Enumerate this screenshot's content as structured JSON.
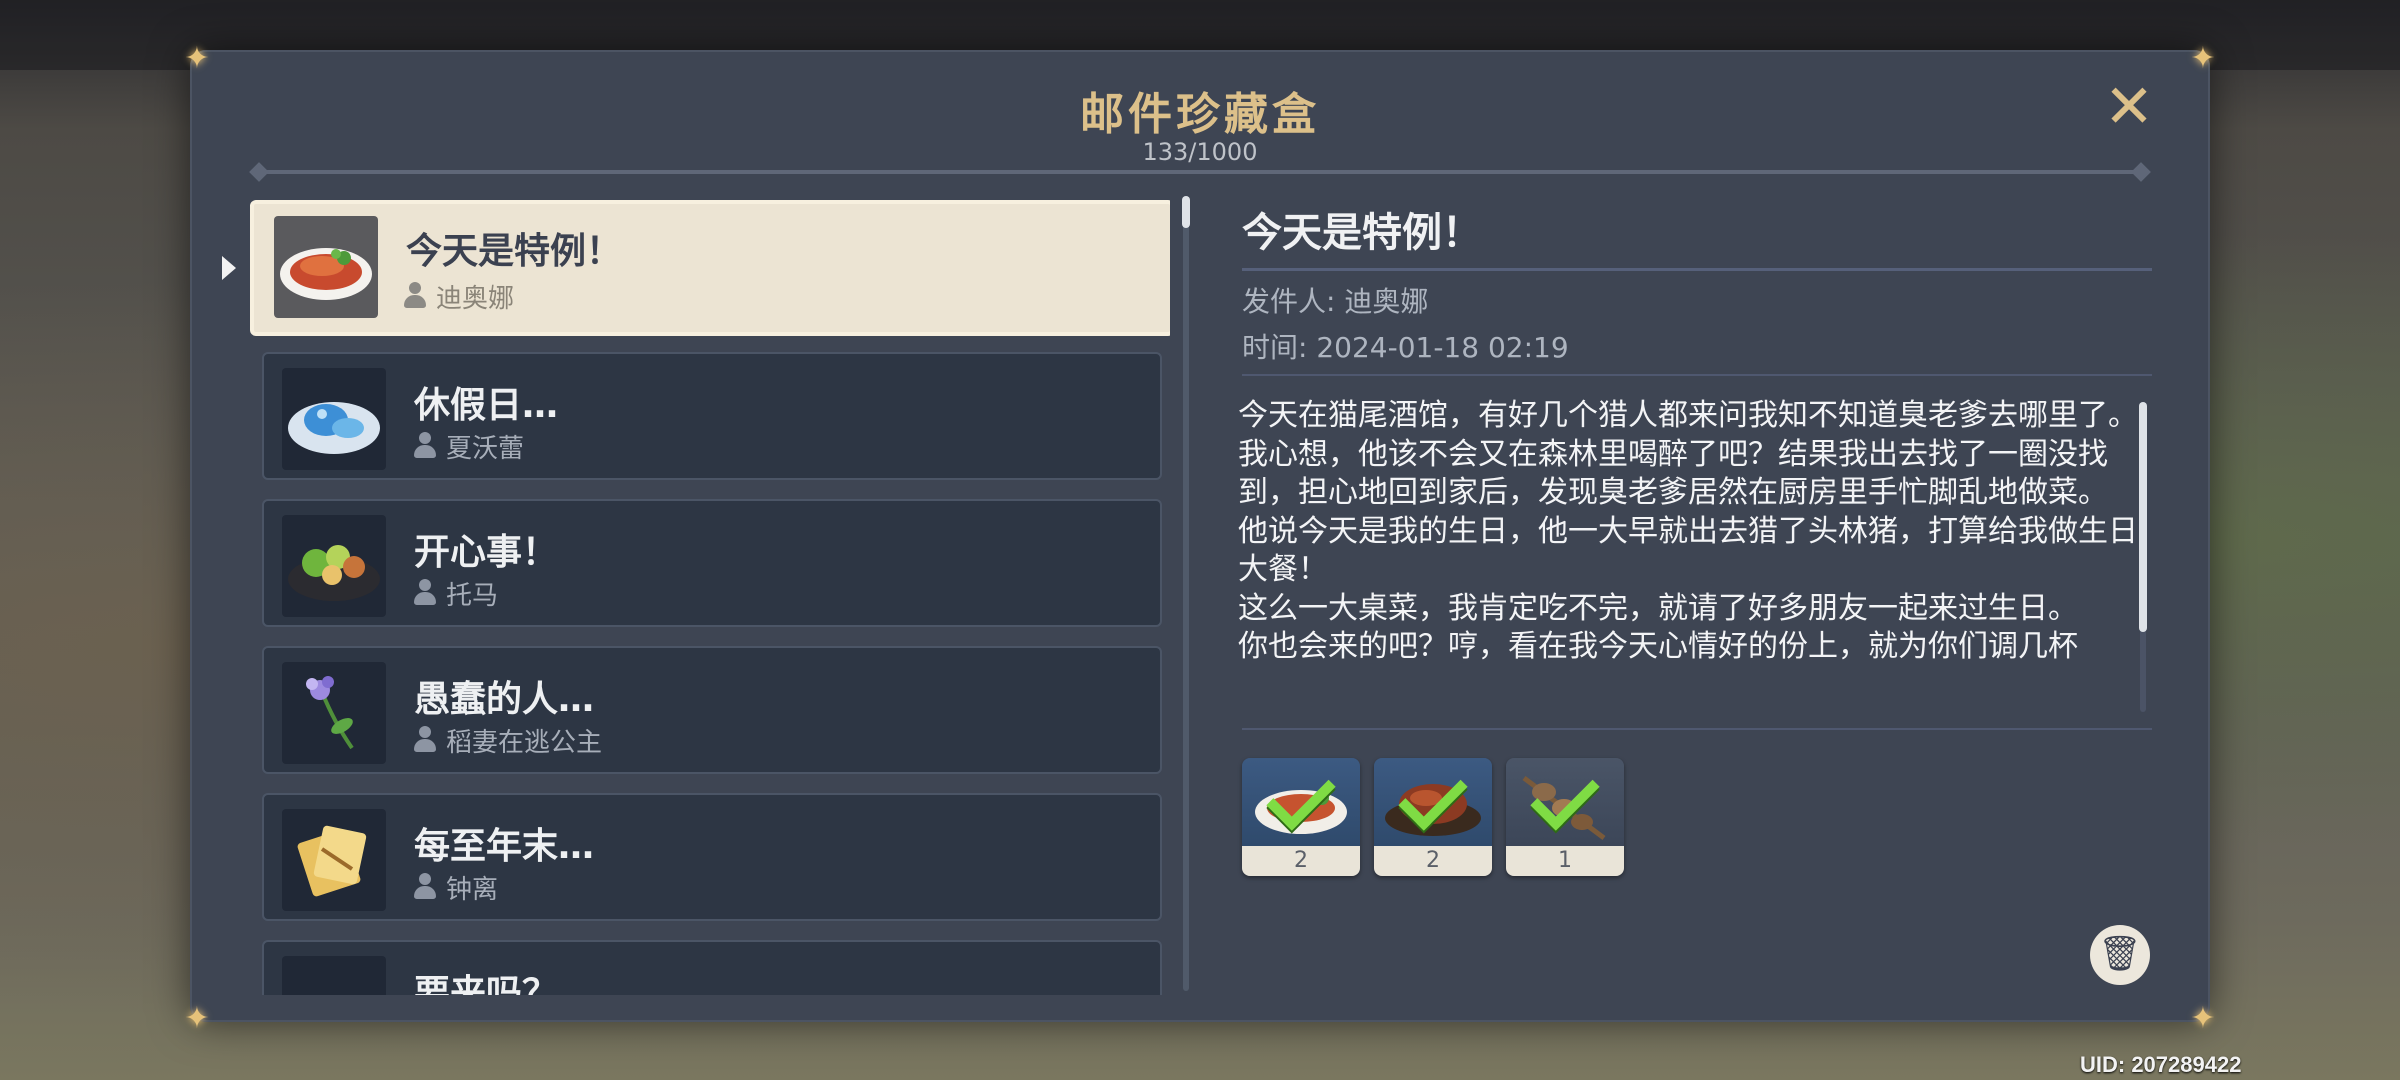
{
  "mailbox": {
    "title": "邮件珍藏盒",
    "count": "133/1000",
    "close_icon": "close-icon"
  },
  "mail_list": [
    {
      "title": "今天是特例！",
      "sender": "迪奥娜",
      "selected": true,
      "icon": "grilled-fish-dish-icon"
    },
    {
      "title": "休假日…",
      "sender": "夏沃蕾",
      "selected": false,
      "icon": "blue-dessert-dish-icon"
    },
    {
      "title": "开心事！",
      "sender": "托马",
      "selected": false,
      "icon": "vegetable-platter-icon"
    },
    {
      "title": "愚蠢的人…",
      "sender": "稻妻在逃公主",
      "selected": false,
      "icon": "purple-flower-icon"
    },
    {
      "title": "每至年末…",
      "sender": "钟离",
      "selected": false,
      "icon": "gold-paper-charm-icon"
    },
    {
      "title": "要来吗？",
      "sender": "",
      "selected": false,
      "icon": "dish-icon"
    }
  ],
  "detail": {
    "title": "今天是特例！",
    "sender_label": "发件人: 迪奥娜",
    "time_label": "时间: 2024-01-18 02:19",
    "body": "今天在猫尾酒馆，有好几个猎人都来问我知不知道臭老爹去哪里了。我心想，他该不会又在森林里喝醉了吧？结果我出去找了一圈没找到，担心地回到家后，发现臭老爹居然在厨房里手忙脚乱地做菜。\n他说今天是我的生日，他一大早就出去猎了头林猪，打算给我做生日大餐！\n这么一大桌菜，我肯定吃不完，就请了好多朋友一起来过生日。\n你也会来的吧？哼，看在我今天心情好的份上，就为你们调几杯",
    "attachments": [
      {
        "icon": "grilled-fish-dish-icon",
        "count": "2",
        "claimed": true
      },
      {
        "icon": "roast-meat-dish-icon",
        "count": "2",
        "claimed": true
      },
      {
        "icon": "meat-skewer-icon",
        "count": "1",
        "claimed": true
      }
    ],
    "delete_icon": "trash-icon"
  },
  "footer": {
    "uid": "UID: 207289422"
  },
  "colors": {
    "accent_gold": "#dcc08a",
    "panel": "#3e4553",
    "selected_item": "#ece4d3",
    "claimed_check": "#7fdc44"
  }
}
